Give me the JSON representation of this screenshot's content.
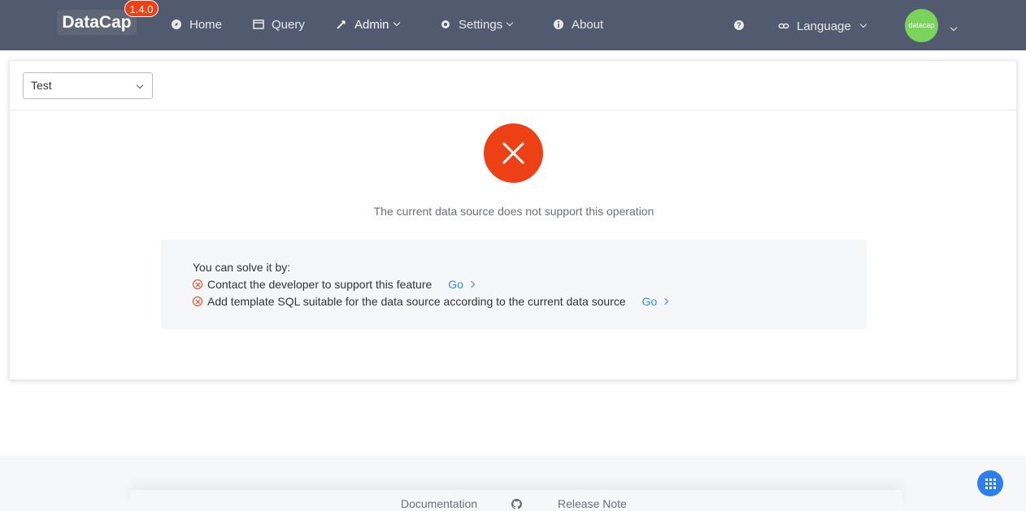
{
  "header": {
    "app_name": "DataCap",
    "version": "1.4.0",
    "nav": {
      "home": "Home",
      "query": "Query",
      "admin": "Admin",
      "settings": "Settings",
      "about": "About",
      "language": "Language"
    },
    "help_symbol": "?",
    "avatar_label": "datacap"
  },
  "toolbar": {
    "source_select_value": "Test"
  },
  "result": {
    "status": "error",
    "title": "The current data source does not support this operation",
    "solve_title": "You can solve it by:",
    "solutions": [
      {
        "text": "Contact the developer to support this feature",
        "link": "Go"
      },
      {
        "text": "Add template SQL suitable for the data source according to the current data source",
        "link": "Go"
      }
    ]
  },
  "footer": {
    "documentation": "Documentation",
    "release_note": "Release Note"
  },
  "watermark_text": "datacap",
  "colors": {
    "header_bg": "#515a6e",
    "error": "#ed4014",
    "link": "#2d8cf0",
    "avatar": "#7ad35a"
  }
}
